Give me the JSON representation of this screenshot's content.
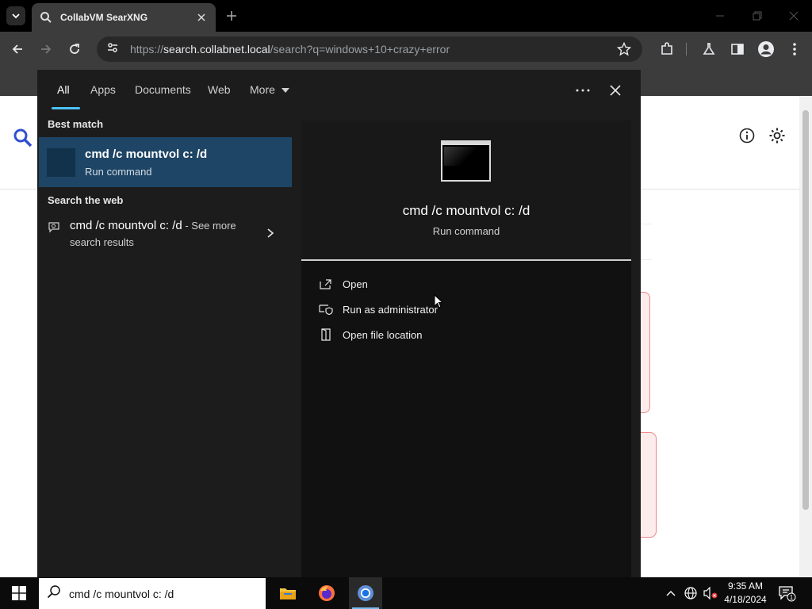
{
  "browser": {
    "tab_title": "CollabVM SearXNG",
    "url_prefix": "https://",
    "url_host": "search.collabnet.local",
    "url_rest": "/search?q=windows+10+crazy+error"
  },
  "search_panel": {
    "filters": [
      "All",
      "Apps",
      "Documents",
      "Web",
      "More"
    ],
    "active_filter": "All",
    "best_match_title": "Best match",
    "best_match": {
      "name": "cmd /c mountvol c: /d",
      "type": "Run command"
    },
    "search_web_title": "Search the web",
    "web_result": {
      "query": "cmd /c mountvol c: /d",
      "see_more_1": " - See more",
      "see_more_2": "search results"
    },
    "preview": {
      "name": "cmd /c mountvol c: /d",
      "type": "Run command",
      "actions": [
        "Open",
        "Run as administrator",
        "Open file location"
      ]
    }
  },
  "taskbar": {
    "search_value": "cmd /c mountvol c: /d",
    "apps": [
      "file-explorer",
      "firefox",
      "chrome"
    ],
    "time": "9:35 AM",
    "date": "4/18/2024",
    "notification_count": "1"
  },
  "colors": {
    "accent": "#4cc2ff",
    "selected_item": "#1e4565",
    "panel_bg": "#1c1c1c"
  }
}
